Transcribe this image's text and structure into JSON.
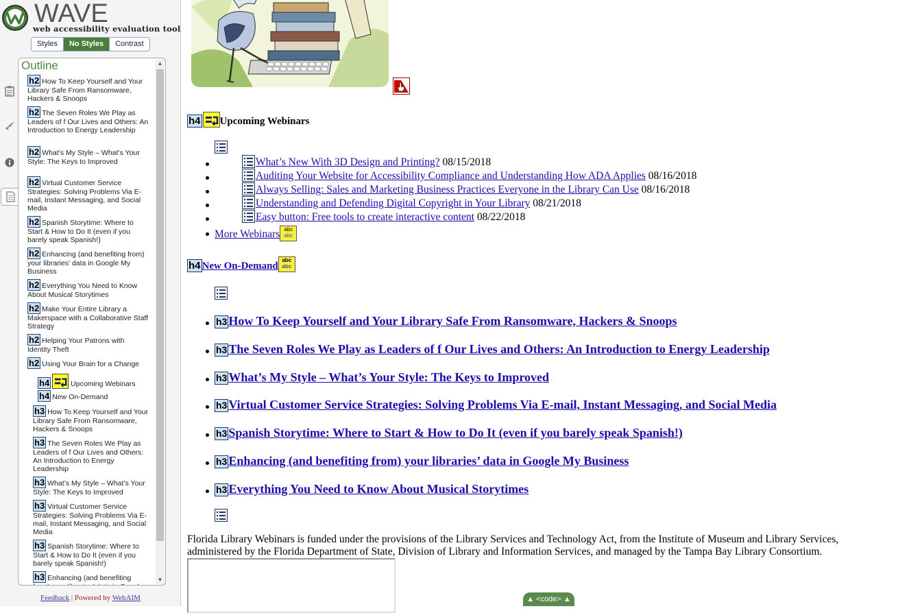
{
  "wave": {
    "logo_word": "WAVE",
    "logo_sub": "web accessibility evaluation tool",
    "style_buttons": [
      "Styles",
      "No Styles",
      "Contrast"
    ],
    "active_style": "No Styles",
    "outline_title": "Outline",
    "footer": {
      "feedback": "Feedback",
      "separator": "|",
      "powered_by": "Powered by",
      "webaim": "WebAIM"
    },
    "icons": [
      "details-icon",
      "tools-icon",
      "info-icon",
      "outline-icon"
    ]
  },
  "outline": [
    {
      "level": "h2",
      "text": "How To Keep Yourself and Your Library Safe From Ransomware, Hackers & Snoops"
    },
    {
      "level": "h2",
      "text": "The Seven Roles We Play as Leaders of f Our Lives and Others: An Introduction to Energy Leadership"
    },
    {
      "level": "h2",
      "text": "What’s My Style – What’s Your Style: The Keys to Improved"
    },
    {
      "level": "h2",
      "text": "Virtual Customer Service Strategies: Solving Problems Via E-mail, Instant Messaging, and Social Media"
    },
    {
      "level": "h2",
      "text": "Spanish Storytime: Where to Start & How to Do It (even if you barely speak Spanish!)"
    },
    {
      "level": "h2",
      "text": "Enhancing (and benefiting from) your libraries’ data in Google My Business"
    },
    {
      "level": "h2",
      "text": "Everything You Need to Know About Musical Storytimes"
    },
    {
      "level": "h2",
      "text": "Make Your Entire Library a Makerspace with a Collaborative Staff Strategy"
    },
    {
      "level": "h2",
      "text": "Helping Your Patrons with Identity Theft"
    },
    {
      "level": "h2",
      "text": "Using Your Brain for a Change"
    },
    {
      "level": "h4",
      "text": "Upcoming Webinars",
      "alert": true
    },
    {
      "level": "h4",
      "text": "New On-Demand"
    },
    {
      "level": "h3",
      "text": "How To Keep Yourself and Your Library Safe From Ransomware, Hackers & Snoops"
    },
    {
      "level": "h3",
      "text": "The Seven Roles We Play as Leaders of f Our Lives and Others: An Introduction to Energy Leadership"
    },
    {
      "level": "h3",
      "text": "What’s My Style – What’s Your Style: The Keys to Improved"
    },
    {
      "level": "h3",
      "text": "Virtual Customer Service Strategies: Solving Problems Via E-mail, Instant Messaging, and Social Media"
    },
    {
      "level": "h3",
      "text": "Spanish Storytime: Where to Start & How to Do It (even if you barely speak Spanish!)"
    },
    {
      "level": "h3",
      "text": "Enhancing (and benefiting from) your libraries’ data in Google My Business"
    }
  ],
  "main": {
    "upcoming_heading": {
      "tag": "h4",
      "text": "Upcoming Webinars"
    },
    "webinars": [
      {
        "title": "What’s New With 3D Design and Printing?",
        "date": "08/15/2018"
      },
      {
        "title": "Auditing Your Website for Accessibility Compliance and Understanding How ADA Applies",
        "date": "08/16/2018"
      },
      {
        "title": "Always Selling: Sales and Marketing Business Practices Everyone in the Library Can Use",
        "date": "08/16/2018"
      },
      {
        "title": "Understanding and Defending Digital Copyright in Your Library",
        "date": "08/21/2018"
      },
      {
        "title": "Easy button: Free tools to create interactive content",
        "date": "08/22/2018"
      }
    ],
    "more_webinars": "More Webinars",
    "abc_icon_text": [
      "abc",
      "abc"
    ],
    "on_demand_heading": {
      "tag": "h4",
      "text": "New On-Demand"
    },
    "on_demand": [
      {
        "tag": "h3",
        "text": "How To Keep Yourself and Your Library Safe From Ransomware, Hackers & Snoops"
      },
      {
        "tag": "h3",
        "text": "The Seven Roles We Play as Leaders of f Our Lives and Others: An Introduction to Energy Leadership"
      },
      {
        "tag": "h3",
        "text": "What’s My Style – What’s Your Style: The Keys to Improved"
      },
      {
        "tag": "h3",
        "text": "Virtual Customer Service Strategies: Solving Problems Via E-mail, Instant Messaging, and Social Media"
      },
      {
        "tag": "h3",
        "text": "Spanish Storytime: Where to Start & How to Do It (even if you barely speak Spanish!)"
      },
      {
        "tag": "h3",
        "text": "Enhancing (and benefiting from) your libraries’ data in Google My Business"
      },
      {
        "tag": "h3",
        "text": "Everything You Need to Know About Musical Storytimes"
      }
    ],
    "funding": "Florida Library Webinars is funded under the provisions of the Library Services and Technology Act, from the Institute of Museum and Library Services, administered by the Florida Department of State, Division of Library and Information Services, and managed by the Tampa Bay Library Consortium.",
    "code_toggle": "<code>"
  },
  "colors": {
    "wave_green": "#4a7d3c",
    "alert_yellow": "#ffff20",
    "heading_blue": "#cde3f5",
    "link": "#1a0dab"
  }
}
